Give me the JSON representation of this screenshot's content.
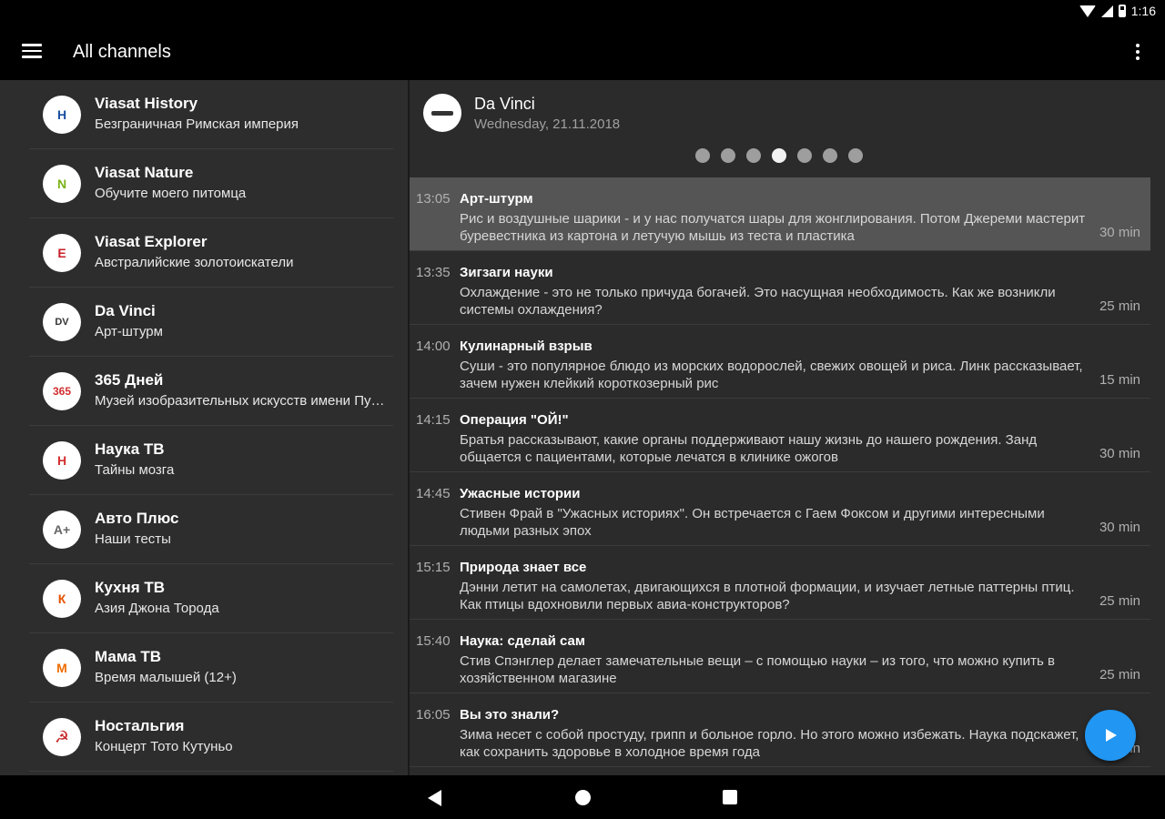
{
  "status_bar": {
    "time": "1:16"
  },
  "app_bar": {
    "title": "All channels"
  },
  "channels": [
    {
      "name": "Viasat History",
      "subtitle": "Безграничная Римская империя",
      "logo_text": "H",
      "logo_color": "#1a4fa0"
    },
    {
      "name": "Viasat Nature",
      "subtitle": "Обучите моего питомца",
      "logo_text": "N",
      "logo_color": "#7ab317"
    },
    {
      "name": "Viasat Explorer",
      "subtitle": "Австралийские золотоискатели",
      "logo_text": "E",
      "logo_color": "#c8202a"
    },
    {
      "name": "Da Vinci",
      "subtitle": "Арт-штурм",
      "logo_text": "DV",
      "logo_color": "#333333"
    },
    {
      "name": "365 Дней",
      "subtitle": "Музей изобразительных искусств имени Пушкина",
      "logo_text": "365",
      "logo_color": "#d32f2f"
    },
    {
      "name": "Наука ТВ",
      "subtitle": "Тайны мозга",
      "logo_text": "Н",
      "logo_color": "#d32f2f"
    },
    {
      "name": "Авто Плюс",
      "subtitle": "Наши тесты",
      "logo_text": "А+",
      "logo_color": "#666666"
    },
    {
      "name": "Кухня ТВ",
      "subtitle": "Азия Джона Торода",
      "logo_text": "К",
      "logo_color": "#e65100"
    },
    {
      "name": "Мама ТВ",
      "subtitle": "Время малышей (12+)",
      "logo_text": "М",
      "logo_color": "#ef6c00"
    },
    {
      "name": "Ностальгия",
      "subtitle": "Концерт Тото Кутуньо",
      "logo_text": "☭",
      "logo_color": "#c62828"
    }
  ],
  "detail": {
    "channel": "Da Vinci",
    "date": "Wednesday, 21.11.2018",
    "page_dots": 7,
    "active_dot": 3,
    "programs": [
      {
        "time": "13:05",
        "title": "Арт-штурм",
        "desc": "Рис и воздушные шарики - и у нас получатся шары для жонглирования. Потом Джереми мастерит буревестника из картона и летучую мышь из теста и пластика",
        "duration": "30 min"
      },
      {
        "time": "13:35",
        "title": "Зигзаги науки",
        "desc": "Охлаждение - это не только причуда богачей. Это насущная необходимость. Как же возникли системы охлаждения?",
        "duration": "25 min"
      },
      {
        "time": "14:00",
        "title": "Кулинарный взрыв",
        "desc": "Суши - это популярное блюдо из морских водорослей, свежих овощей и риса. Линк рассказывает, зачем нужен клейкий короткозерный рис",
        "duration": "15 min"
      },
      {
        "time": "14:15",
        "title": "Операция \"ОЙ!\"",
        "desc": "Братья рассказывают, какие органы поддерживают нашу жизнь до нашего рождения. Занд общается с пациентами, которые лечатся в клинике ожогов",
        "duration": "30 min"
      },
      {
        "time": "14:45",
        "title": "Ужасные истории",
        "desc": "Стивен Фрай в \"Ужасных историях\". Он встречается с Гаем Фоксом и другими интересными людьми разных эпох",
        "duration": "30 min"
      },
      {
        "time": "15:15",
        "title": "Природа знает все",
        "desc": "Дэнни летит на самолетах, двигающихся в плотной формации, и изучает летные паттерны птиц. Как птицы вдохновили первых авиа-конструкторов?",
        "duration": "25 min"
      },
      {
        "time": "15:40",
        "title": "Наука: сделай сам",
        "desc": "Стив Спэнглер делает замечательные вещи – с помощью науки – из того, что можно купить в хозяйственном магазине",
        "duration": "25 min"
      },
      {
        "time": "16:05",
        "title": "Вы это знали?",
        "desc": "Зима несет с собой простуду, грипп и больное горло. Но этого можно избежать. Наука подскажет, как сохранить здоровье в холодное время года",
        "duration": "25 min"
      }
    ]
  },
  "colors": {
    "accent": "#2196f3",
    "panel": "#2d2d2d",
    "selected_row": "#555555"
  },
  "icons": {
    "menu": "menu-icon",
    "overflow": "more-vert-icon",
    "fab": "play-icon"
  }
}
